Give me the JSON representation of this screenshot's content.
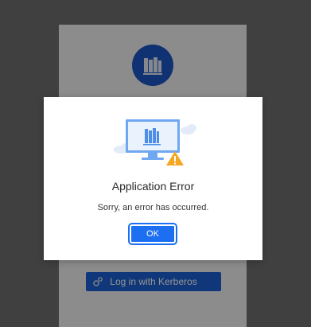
{
  "background": {
    "kerberos_button_label": "Log in with Kerberos",
    "logo_icon": "library-books-icon",
    "kerberos_icon": "gears-icon"
  },
  "dialog": {
    "title": "Application Error",
    "message": "Sorry, an error has occurred.",
    "ok_label": "OK",
    "illustration_icon": "monitor-warning-icon"
  },
  "colors": {
    "primary": "#1d6ff2",
    "logo_blue": "#1d56c4",
    "warning": "#f5a623"
  }
}
